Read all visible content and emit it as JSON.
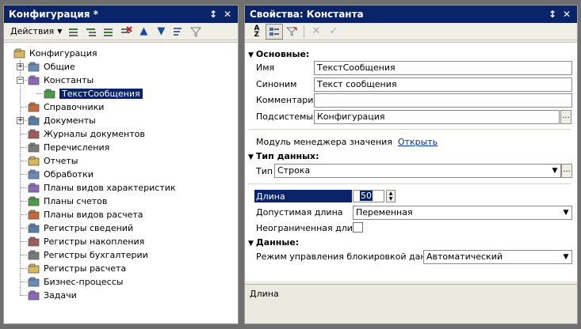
{
  "left": {
    "title": "Конфигурация *",
    "actions_label": "Действия",
    "tree": [
      {
        "label": "Конфигурация",
        "icon": "config-icon",
        "level": 0,
        "expander": "",
        "selected": false
      },
      {
        "label": "Общие",
        "icon": "common-icon",
        "level": 1,
        "expander": "+",
        "selected": false
      },
      {
        "label": "Константы",
        "icon": "constants-icon",
        "level": 1,
        "expander": "-",
        "selected": false
      },
      {
        "label": "ТекстСообщения",
        "icon": "constant-item-icon",
        "level": 2,
        "expander": "",
        "selected": true
      },
      {
        "label": "Справочники",
        "icon": "catalogs-icon",
        "level": 1,
        "expander": "",
        "selected": false
      },
      {
        "label": "Документы",
        "icon": "documents-icon",
        "level": 1,
        "expander": "+",
        "selected": false
      },
      {
        "label": "Журналы документов",
        "icon": "journals-icon",
        "level": 1,
        "expander": "",
        "selected": false
      },
      {
        "label": "Перечисления",
        "icon": "enums-icon",
        "level": 1,
        "expander": "",
        "selected": false
      },
      {
        "label": "Отчеты",
        "icon": "reports-icon",
        "level": 1,
        "expander": "",
        "selected": false
      },
      {
        "label": "Обработки",
        "icon": "processing-icon",
        "level": 1,
        "expander": "",
        "selected": false
      },
      {
        "label": "Планы видов характеристик",
        "icon": "char-types-icon",
        "level": 1,
        "expander": "",
        "selected": false
      },
      {
        "label": "Планы счетов",
        "icon": "accounts-chart-icon",
        "level": 1,
        "expander": "",
        "selected": false
      },
      {
        "label": "Планы видов расчета",
        "icon": "calc-types-icon",
        "level": 1,
        "expander": "",
        "selected": false
      },
      {
        "label": "Регистры сведений",
        "icon": "info-registers-icon",
        "level": 1,
        "expander": "",
        "selected": false
      },
      {
        "label": "Регистры накопления",
        "icon": "accum-registers-icon",
        "level": 1,
        "expander": "",
        "selected": false
      },
      {
        "label": "Регистры бухгалтерии",
        "icon": "acct-registers-icon",
        "level": 1,
        "expander": "",
        "selected": false
      },
      {
        "label": "Регистры расчета",
        "icon": "calc-registers-icon",
        "level": 1,
        "expander": "",
        "selected": false
      },
      {
        "label": "Бизнес-процессы",
        "icon": "business-process-icon",
        "level": 1,
        "expander": "",
        "selected": false
      },
      {
        "label": "Задачи",
        "icon": "tasks-icon",
        "level": 1,
        "expander": "",
        "selected": false
      }
    ]
  },
  "right": {
    "title": "Свойства: Константа",
    "sections": {
      "basic": "Основные:",
      "data_type": "Тип данных:",
      "data": "Данные:"
    },
    "labels": {
      "name": "Имя",
      "synonym": "Синоним",
      "comment": "Комментарий",
      "subsystems": "Подсистемы",
      "value_manager": "Модуль менеджера значения",
      "open_link": "Открыть",
      "type": "Тип",
      "length": "Длина",
      "allowed_length": "Допустимая длина",
      "unlimited_length": "Неограниченная длина",
      "lock_mode": "Режим управления блокировкой данных"
    },
    "values": {
      "name": "ТекстСообщения",
      "synonym": "Текст сообщения",
      "comment": "",
      "subsystems": "Конфигурация",
      "type": "Строка",
      "length": "50",
      "allowed_length": "Переменная",
      "unlimited_length": false,
      "lock_mode": "Автоматический"
    },
    "description": "Длина"
  },
  "colors": {
    "titlebar": "#0a246a",
    "selection": "#0a246a",
    "panel_bg": "#f0efe7",
    "link": "#003399"
  }
}
